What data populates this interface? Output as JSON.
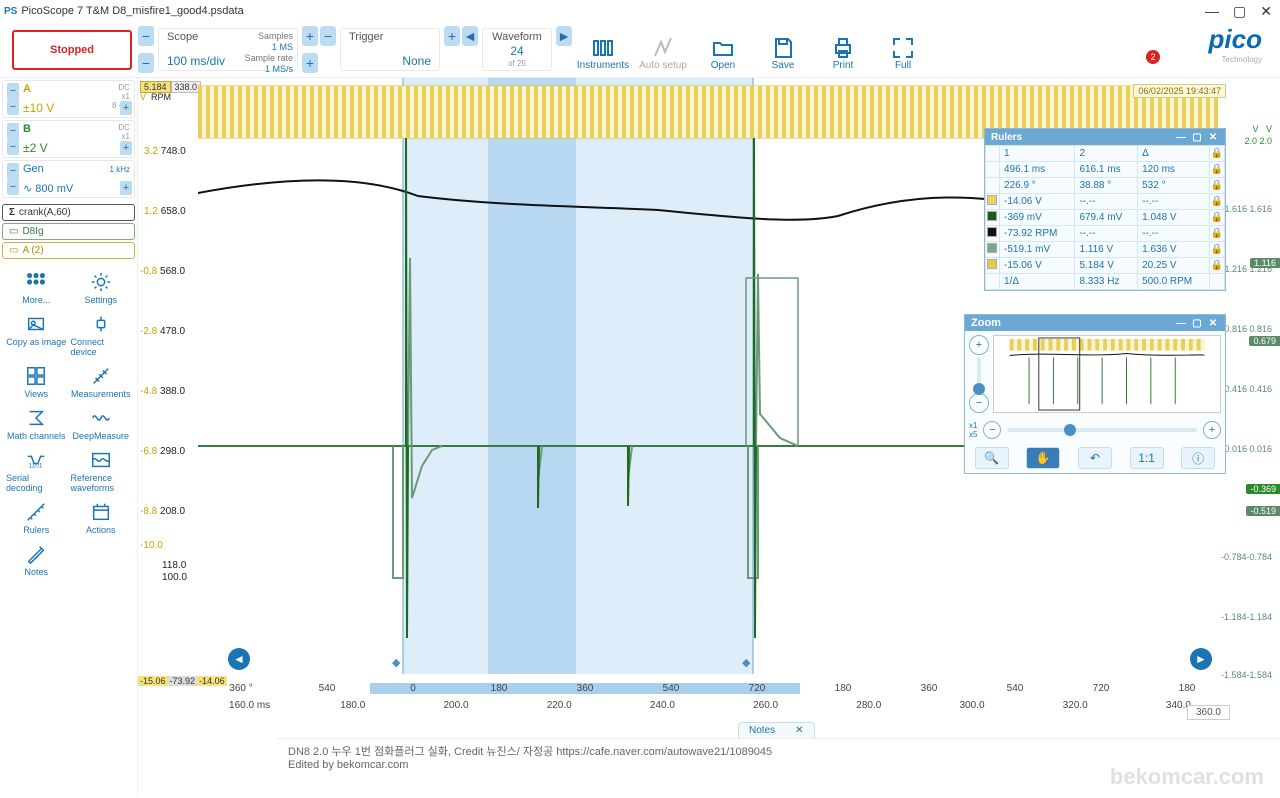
{
  "window": {
    "title": "PicoScope 7 T&M D8_misfire1_good4.psdata",
    "app_icon": "PS"
  },
  "toolbar": {
    "stopped": "Stopped",
    "scope": {
      "title": "Scope",
      "value": "100 ms/div",
      "samples_l": "Samples",
      "samples_v": "1 MS",
      "rate_l": "Sample rate",
      "rate_v": "1 MS/s"
    },
    "trigger": {
      "title": "Trigger",
      "value": "None"
    },
    "waveform": {
      "title": "Waveform",
      "value": "24",
      "of": "of 25"
    },
    "buttons": {
      "instruments": "Instruments",
      "auto": "Auto setup",
      "open": "Open",
      "save": "Save",
      "print": "Print",
      "full": "Full"
    },
    "logo": "pico",
    "logo_sub": "Technology",
    "badge": "2"
  },
  "channels": {
    "A": {
      "name": "A",
      "range": "±10 V",
      "coupling": "DC",
      "res": "x1",
      "bits": "8 + 4"
    },
    "B": {
      "name": "B",
      "range": "±2 V",
      "coupling": "DC",
      "res": "x1"
    },
    "gen": {
      "name": "Gen",
      "freq": "1 kHz",
      "shape": "∿",
      "amp": "800 mV"
    }
  },
  "math": {
    "crank": "crank(A,60)",
    "d8": "D8Ig",
    "a2": "A (2)"
  },
  "side": [
    "More...",
    "Settings",
    "Copy as image",
    "Connect device",
    "Views",
    "Measurements",
    "Math channels",
    "DeepMeasure",
    "Serial decoding",
    "Reference waveforms",
    "Rulers",
    "Actions",
    "Notes"
  ],
  "y_left": {
    "top_tag": "5.184",
    "top_tag2": "338.0",
    "vlabel": "V",
    "rpm": "RPM",
    "rows": [
      {
        "v": "3.2",
        "rpm": "748.0"
      },
      {
        "v": "1.2",
        "rpm": "658.0"
      },
      {
        "v": "-0.8",
        "rpm": "568.0"
      },
      {
        "v": "-2.8",
        "rpm": "478.0"
      },
      {
        "v": "-4.8",
        "rpm": "388.0"
      },
      {
        "v": "-6.8",
        "rpm": "298.0"
      },
      {
        "v": "-8.8",
        "rpm": "208.0"
      }
    ],
    "v_low": "-10.0",
    "tail1": "118.0",
    "tail2": "100.0",
    "bottom_tag": "-15.06",
    "bottom_tag2": "-73.92",
    "bottom_tag3": "-14.06"
  },
  "right_axis": {
    "headV": "V",
    "headV2": "V",
    "head2": "2.0",
    "head22": "2.0",
    "rows": [
      "1.616 1.616",
      "1.216 1.216",
      "0.816 0.816",
      "0.416 0.416",
      "0.016 0.016",
      "-0.784-0.784",
      "-1.184-1.184",
      "-1.584-1.584"
    ],
    "tags": {
      "t1": "1.116",
      "t2": "0.679",
      "t3": "-0.369",
      "t4": "-0.519"
    }
  },
  "timestamp": "06/02/2025 19:43:47",
  "rulers": {
    "title": "Rulers",
    "head": [
      "1",
      "2",
      "Δ"
    ],
    "rows": [
      {
        "sw": "",
        "c1": "496.1 ms",
        "c2": "616.1 ms",
        "d": "120 ms"
      },
      {
        "sw": "",
        "c1": "226.9 °",
        "c2": "38.88 °",
        "d": "532 °"
      },
      {
        "sw": "sw-y",
        "c1": "-14.06 V",
        "c2": "--.--",
        "d": "--.--"
      },
      {
        "sw": "sw-dg",
        "c1": "-369 mV",
        "c2": "679.4 mV",
        "d": "1.048 V"
      },
      {
        "sw": "sw-bk",
        "c1": "-73.92 RPM",
        "c2": "--.--",
        "d": "--.--"
      },
      {
        "sw": "sw-sg",
        "c1": "-519.1 mV",
        "c2": "1.116 V",
        "d": "1.636 V"
      },
      {
        "sw": "sw-gold",
        "c1": "-15.06 V",
        "c2": "5.184 V",
        "d": "20.25 V"
      }
    ],
    "foot": {
      "l": "1/Δ",
      "c": "8.333 Hz",
      "r": "500.0 RPM"
    }
  },
  "zoom": {
    "title": "Zoom",
    "x1": "x1",
    "x5": "x5",
    "ratio": "1:1"
  },
  "deg_axis": [
    "360 °",
    "540",
    "0",
    "180",
    "360",
    "540",
    "720",
    "180",
    "360",
    "540",
    "720",
    "180"
  ],
  "time_axis": [
    "160.0 ms",
    "180.0",
    "200.0",
    "220.0",
    "240.0",
    "260.0",
    "280.0",
    "300.0",
    "320.0",
    "340.0"
  ],
  "time_end": "360.0",
  "notes_tab": "Notes",
  "footer": {
    "l1": "DN8 2.0 누우 1번 점화플러그 실화, Credit 뉴진스/ 자정공 https://cafe.naver.com/autowave21/1089045",
    "l2": "Edited by bekomcar.com",
    "wm": "bekomcar.com"
  },
  "chart_data": {
    "type": "line",
    "xlabel": "ms / crank angle °",
    "ylim_rpm": [
      100,
      748
    ],
    "ylim_v_dg": [
      -1.584,
      2.0
    ],
    "x_time_ms": [
      160,
      180,
      200,
      220,
      240,
      260,
      280,
      300,
      320,
      340,
      360
    ],
    "series": [
      {
        "name": "RPM (black)",
        "unit": "RPM",
        "approx_values_at_x": [
          690,
          700,
          680,
          672,
          668,
          660,
          672,
          700,
          688,
          672,
          676
        ]
      },
      {
        "name": "D8Ig (sea-green)",
        "unit": "V",
        "baseline": -0.016,
        "spikes_ms": [
          198,
          222,
          246,
          267
        ],
        "spike_min": -1.5,
        "spike_max": 1.4
      },
      {
        "name": "Channel B (dark-green)",
        "unit": "V",
        "baseline": -0.016,
        "large_spikes_ms": [
          199,
          268
        ],
        "small_spikes_ms": [
          222,
          245
        ]
      },
      {
        "name": "Channel A (yellow)",
        "unit": "V",
        "type": "square",
        "hi": 5.18,
        "lo": -15,
        "period_ms": 2
      }
    ],
    "highlighted_region_ms": [
      200,
      268
    ],
    "cursors_ms": [
      496.1,
      616.1
    ]
  }
}
